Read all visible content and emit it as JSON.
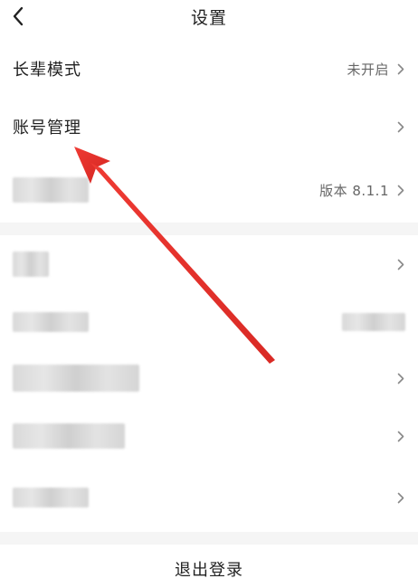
{
  "header": {
    "title": "设置",
    "back_icon": "chevron-left-icon"
  },
  "rows": [
    {
      "label": "长辈模式",
      "value": "未开启"
    },
    {
      "label": "账号管理",
      "value": ""
    },
    {
      "label": "",
      "value": "版本 8.1.1"
    }
  ],
  "logout": {
    "label": "退出登录"
  },
  "colors": {
    "background": "#ffffff",
    "separator": "#f5f5f5",
    "annotation_arrow": "#e8302b"
  }
}
